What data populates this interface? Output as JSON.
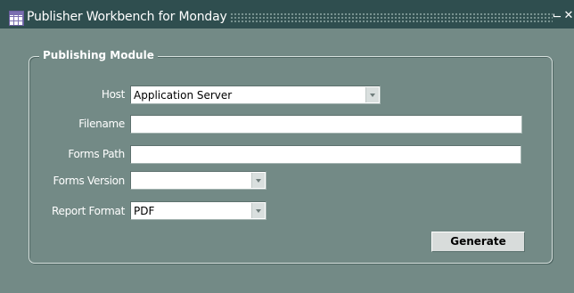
{
  "window": {
    "title": "Publisher Workbench for Monday",
    "icon": "grid-table-icon",
    "minimize_glyph": "⌙",
    "close_glyph": "✕"
  },
  "frame": {
    "title": "Publishing Module"
  },
  "form": {
    "host": {
      "label": "Host",
      "value": "Application Server"
    },
    "filename": {
      "label": "Filename",
      "value": ""
    },
    "forms_path": {
      "label": "Forms Path",
      "value": ""
    },
    "forms_version": {
      "label": "Forms Version",
      "value": ""
    },
    "report_format": {
      "label": "Report Format",
      "value": "PDF"
    }
  },
  "actions": {
    "generate_label": "Generate"
  },
  "colors": {
    "titlebar": "#2f4e4f",
    "background": "#738a86",
    "text": "#ffffff"
  }
}
